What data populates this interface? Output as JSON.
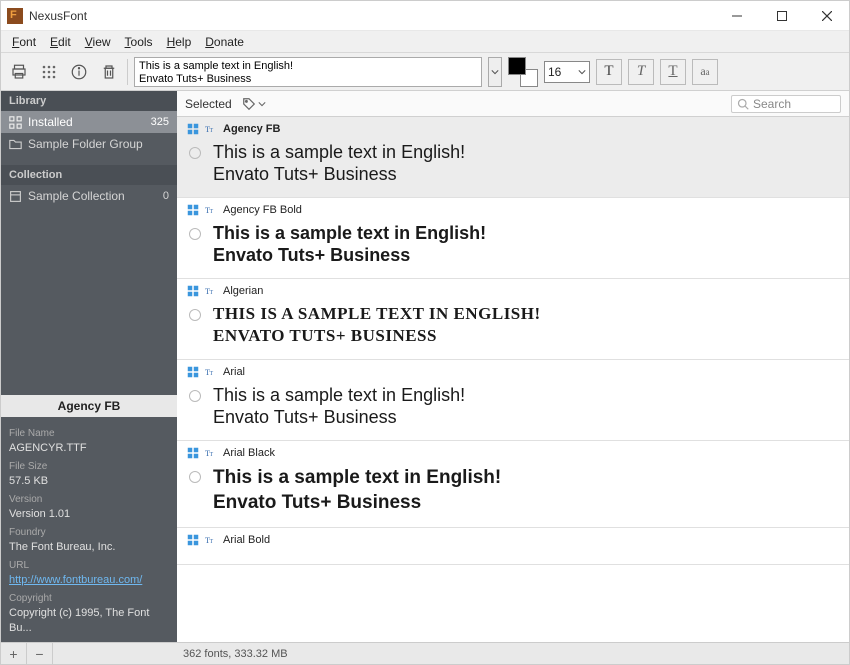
{
  "window": {
    "title": "NexusFont"
  },
  "menu": {
    "font": "Font",
    "edit": "Edit",
    "view": "View",
    "tools": "Tools",
    "help": "Help",
    "donate": "Donate"
  },
  "toolbar": {
    "sample_text": "This is a sample text in English!\nEnvato Tuts+ Business",
    "font_size": "16"
  },
  "sidebar": {
    "library_label": "Library",
    "installed": {
      "label": "Installed",
      "count": "325"
    },
    "folder_group": {
      "label": "Sample Folder Group"
    },
    "collection_label": "Collection",
    "sample_collection": {
      "label": "Sample Collection",
      "count": "0"
    },
    "selected_font": "Agency FB",
    "details": {
      "filename_label": "File Name",
      "filename": "AGENCYR.TTF",
      "filesize_label": "File Size",
      "filesize": "57.5 KB",
      "version_label": "Version",
      "version": "Version 1.01",
      "foundry_label": "Foundry",
      "foundry": "The Font Bureau, Inc.",
      "url_label": "URL",
      "url": "http://www.fontbureau.com/",
      "copyright_label": "Copyright",
      "copyright": "Copyright (c) 1995, The Font Bu..."
    }
  },
  "content": {
    "selected_label": "Selected",
    "search_placeholder": "Search"
  },
  "fonts": [
    {
      "name": "Agency FB",
      "bold": true,
      "sample1": "This is a sample text in English!",
      "sample2": "Envato Tuts+ Business",
      "css": "font-family:'Agency FB','Arial Narrow',sans-serif;font-size:18px;font-stretch:condensed;line-height:22px;"
    },
    {
      "name": "Agency FB Bold",
      "sample1": "This is a sample text in English!",
      "sample2": "Envato Tuts+ Business",
      "css": "font-family:'Agency FB','Arial Narrow',sans-serif;font-weight:bold;font-size:18px;font-stretch:condensed;line-height:22px;"
    },
    {
      "name": "Algerian",
      "sample1": "THIS IS A SAMPLE TEXT IN ENGLISH!",
      "sample2": "ENVATO TUTS+ BUSINESS",
      "css": "font-family:Algerian,'Wide Latin','Times New Roman',serif;font-size:17px;font-weight:bold;letter-spacing:0.5px;line-height:22px;"
    },
    {
      "name": "Arial",
      "sample1": "This is a sample text in English!",
      "sample2": "Envato Tuts+ Business",
      "css": "font-family:Arial,sans-serif;font-size:18px;line-height:22px;"
    },
    {
      "name": "Arial Black",
      "sample1": "This is a sample text in English!",
      "sample2": "Envato Tuts+ Business",
      "css": "font-family:'Arial Black',Arial,sans-serif;font-weight:900;font-size:19px;line-height:25px;"
    },
    {
      "name": "Arial Bold",
      "sample1": "",
      "sample2": "",
      "css": ""
    }
  ],
  "status": {
    "text": "362 fonts, 333.32 MB"
  }
}
